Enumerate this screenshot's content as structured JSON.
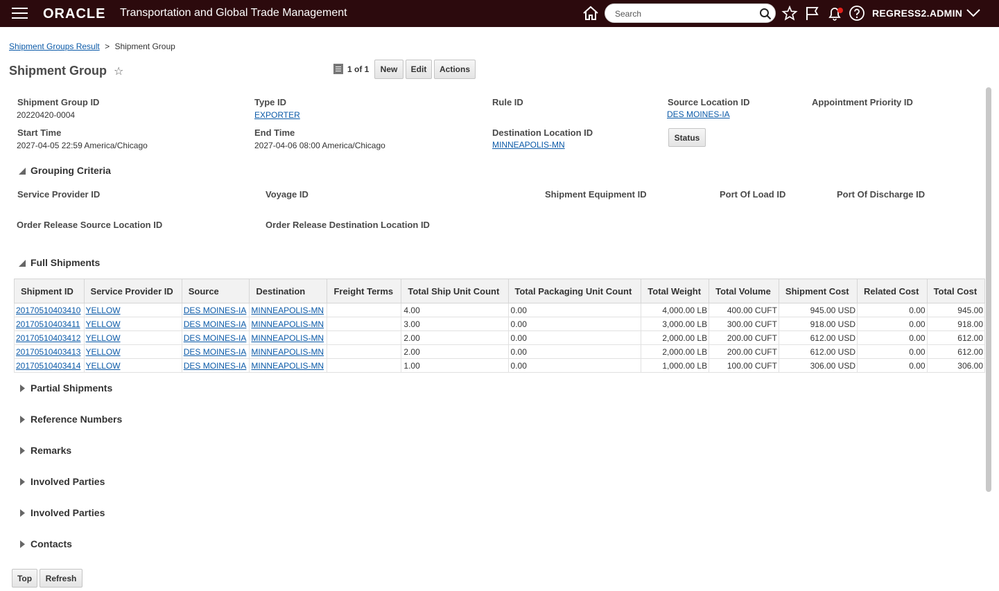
{
  "header": {
    "logo": "ORACLE",
    "app_title": "Transportation and Global Trade Management",
    "search_placeholder": "Search",
    "username": "REGRESS2.ADMIN"
  },
  "breadcrumb": {
    "parent": "Shipment Groups Result",
    "separator": ">",
    "current": "Shipment Group"
  },
  "page": {
    "title": "Shipment Group",
    "record_nav": "1 of 1",
    "buttons": {
      "new": "New",
      "edit": "Edit",
      "actions": "Actions",
      "status": "Status"
    }
  },
  "fields": {
    "shipment_group_id": {
      "label": "Shipment Group ID",
      "value": "20220420-0004"
    },
    "type_id": {
      "label": "Type ID",
      "value": "EXPORTER"
    },
    "rule_id": {
      "label": "Rule ID"
    },
    "source_location_id": {
      "label": "Source Location ID",
      "value": "DES MOINES-IA"
    },
    "appointment_priority_id": {
      "label": "Appointment Priority ID"
    },
    "start_time": {
      "label": "Start Time",
      "value": "2027-04-05 22:59 America/Chicago"
    },
    "end_time": {
      "label": "End Time",
      "value": "2027-04-06 08:00 America/Chicago"
    },
    "destination_location_id": {
      "label": "Destination Location ID",
      "value": "MINNEAPOLIS-MN"
    }
  },
  "grouping_criteria": {
    "title": "Grouping Criteria",
    "labels": {
      "service_provider": "Service Provider ID",
      "voyage": "Voyage ID",
      "shipment_equipment": "Shipment Equipment ID",
      "port_of_load": "Port Of Load ID",
      "port_of_discharge": "Port Of Discharge ID",
      "or_source_location": "Order Release Source Location ID",
      "or_destination_location": "Order Release Destination Location ID"
    }
  },
  "full_shipments": {
    "title": "Full Shipments",
    "columns": [
      "Shipment ID",
      "Service Provider ID",
      "Source",
      "Destination",
      "Freight Terms",
      "Total Ship Unit Count",
      "Total Packaging Unit Count",
      "Total Weight",
      "Total Volume",
      "Shipment Cost",
      "Related Cost",
      "Total Cost"
    ],
    "rows": [
      [
        "20170510403410",
        "YELLOW",
        "DES MOINES-IA",
        "MINNEAPOLIS-MN",
        "",
        "4.00",
        "0.00",
        "4,000.00 LB",
        "400.00 CUFT",
        "945.00 USD",
        "0.00",
        "945.00"
      ],
      [
        "20170510403411",
        "YELLOW",
        "DES MOINES-IA",
        "MINNEAPOLIS-MN",
        "",
        "3.00",
        "0.00",
        "3,000.00 LB",
        "300.00 CUFT",
        "918.00 USD",
        "0.00",
        "918.00"
      ],
      [
        "20170510403412",
        "YELLOW",
        "DES MOINES-IA",
        "MINNEAPOLIS-MN",
        "",
        "2.00",
        "0.00",
        "2,000.00 LB",
        "200.00 CUFT",
        "612.00 USD",
        "0.00",
        "612.00"
      ],
      [
        "20170510403413",
        "YELLOW",
        "DES MOINES-IA",
        "MINNEAPOLIS-MN",
        "",
        "2.00",
        "0.00",
        "2,000.00 LB",
        "200.00 CUFT",
        "612.00 USD",
        "0.00",
        "612.00"
      ],
      [
        "20170510403414",
        "YELLOW",
        "DES MOINES-IA",
        "MINNEAPOLIS-MN",
        "",
        "1.00",
        "0.00",
        "1,000.00 LB",
        "100.00 CUFT",
        "306.00 USD",
        "0.00",
        "306.00"
      ]
    ]
  },
  "collapsed_sections": [
    "Partial Shipments",
    "Reference Numbers",
    "Remarks",
    "Involved Parties",
    "Involved Parties",
    "Contacts"
  ],
  "footer": {
    "top": "Top",
    "refresh": "Refresh"
  },
  "colors": {
    "header_bg": "#2c0a0d",
    "link": "#0b5aa8",
    "notification_dot": "#e0201a"
  }
}
